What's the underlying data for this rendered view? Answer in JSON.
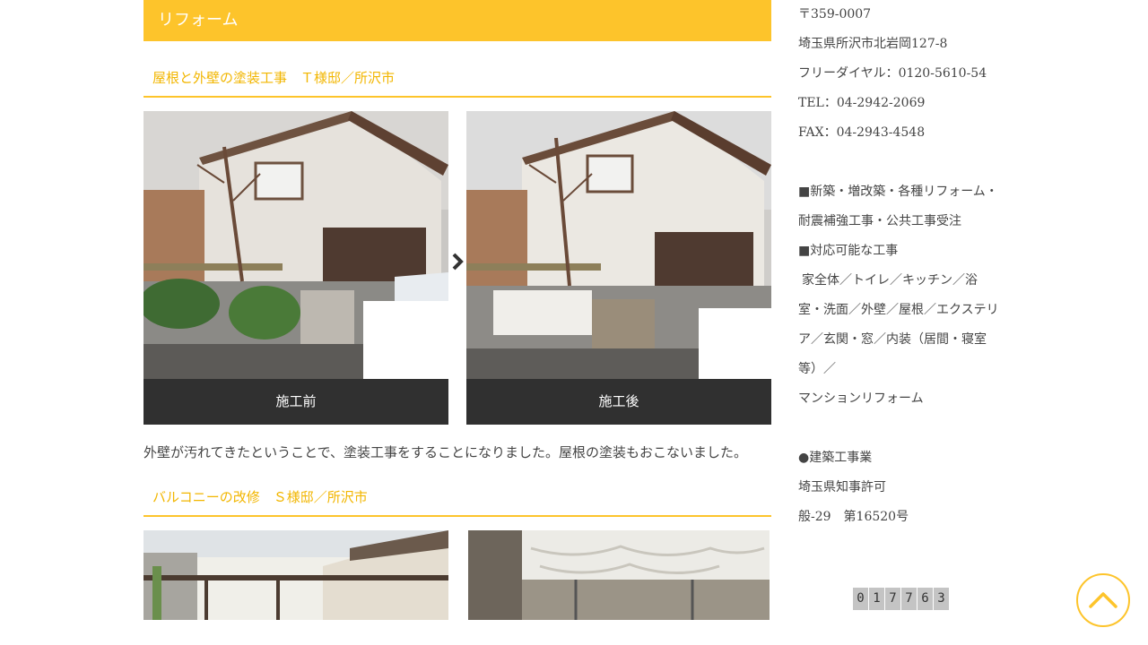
{
  "section": {
    "title": "リフォーム"
  },
  "work1": {
    "title": "屋根と外壁の塗装工事　Ｔ様邸／所沢市",
    "before_caption": "施工前",
    "after_caption": "施工後",
    "description": "外壁が汚れてきたということで、塗装工事をすることになりました。屋根の塗装もおこないました。"
  },
  "work2": {
    "title": "バルコニーの改修　Ｓ様邸／所沢市"
  },
  "sidebar": {
    "postal": "〒359-0007",
    "address": "埼玉県所沢市北岩岡127-8",
    "freedial": "フリーダイヤル：0120-5610-54",
    "tel": "TEL：04-2942-2069",
    "fax": "FAX：04-2943-4548",
    "service_line1": "■新築・増改築・各種リフォーム・",
    "service_line2": "耐震補強工事・公共工事受注",
    "works_heading": "■対応可能な工事",
    "works_line1": "家全体／トイレ／キッチン／浴",
    "works_line2": "室・洗面／外壁／屋根／エクステリ",
    "works_line3": "ア／玄関・窓／内装（居間・寝室",
    "works_line4": "等）／",
    "works_line5": "マンションリフォーム",
    "license_heading": "●建築工事業",
    "license_line1": "埼玉県知事許可",
    "license_line2": "般-29　第16520号"
  },
  "counter": {
    "digits": [
      "0",
      "1",
      "7",
      "7",
      "6",
      "3"
    ]
  },
  "icons": {
    "arrow": "chevron-right-icon",
    "scroll_top": "chevron-up-icon"
  },
  "colors": {
    "accent": "#fdc42b",
    "caption_bg": "#303030"
  }
}
